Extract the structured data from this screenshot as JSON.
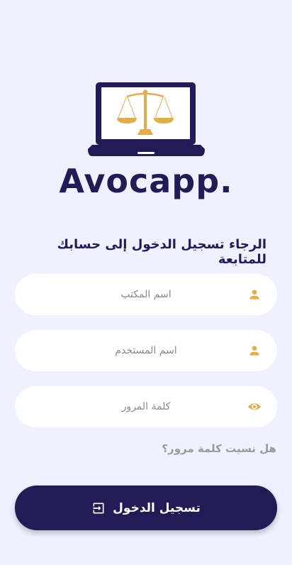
{
  "brand": {
    "app_name": "Avocapp.",
    "primary_color": "#231b55",
    "accent_color": "#e3ac4f",
    "background_color": "#eff2fe"
  },
  "login": {
    "prompt": "الرجاء تسجيل الدخول إلى حسابك للمتابعة",
    "office_name_placeholder": "اسم المكتب",
    "office_name_icon": "person-icon",
    "username_placeholder": "اسم المستخدم",
    "username_icon": "person-icon",
    "password_placeholder": "كلمة المرور",
    "password_icon": "eye-icon",
    "forgot_password": "هل نسيت كلمة مرور؟",
    "submit_label": "تسجيل الدخول",
    "submit_icon": "login-icon"
  }
}
